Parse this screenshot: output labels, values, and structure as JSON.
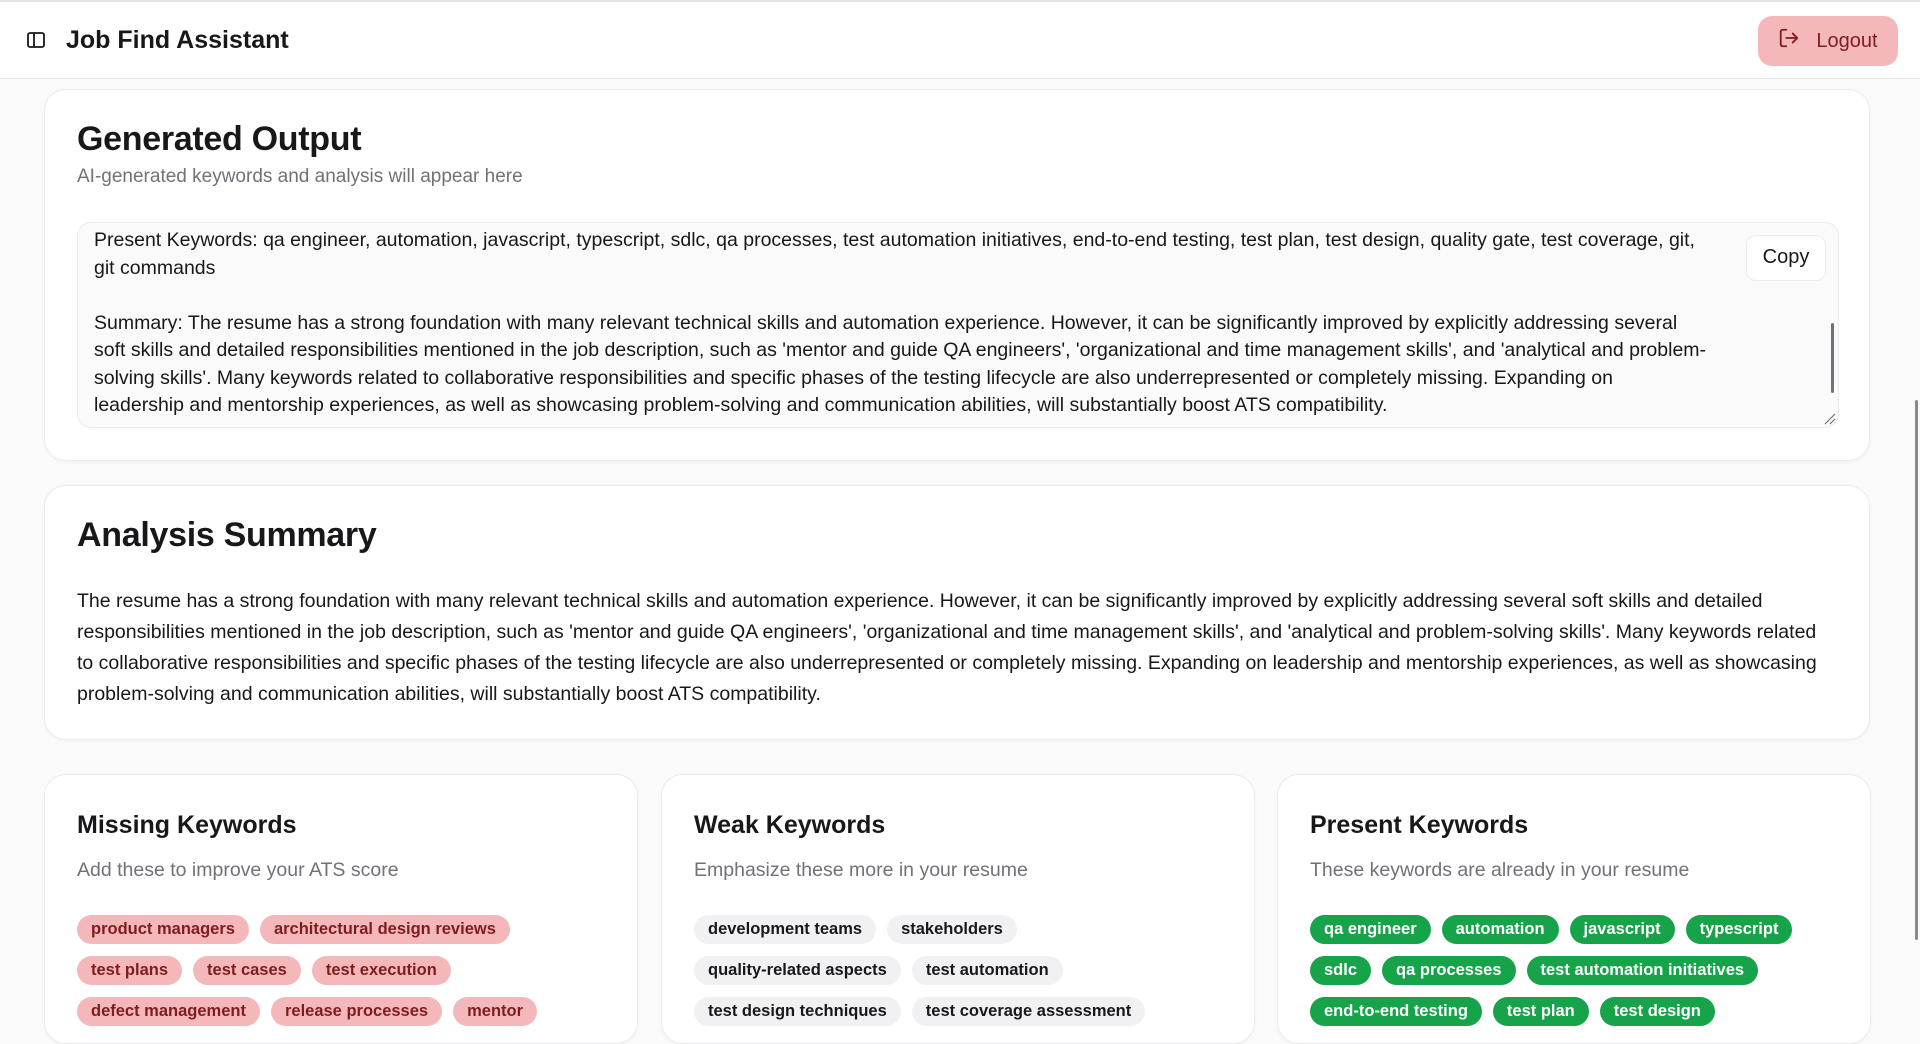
{
  "header": {
    "title": "Job Find Assistant",
    "logout_label": "Logout"
  },
  "generated_output": {
    "title": "Generated Output",
    "subtitle": "AI-generated keywords and analysis will appear here",
    "present_line": "Present Keywords: qa engineer, automation, javascript, typescript, sdlc, qa processes, test automation initiatives, end-to-end testing, test plan, test design, quality gate, test coverage, git, git commands",
    "summary_line": "Summary: The resume has a strong foundation with many relevant technical skills and automation experience. However, it can be significantly improved by explicitly addressing several soft skills and detailed responsibilities mentioned in the job description, such as 'mentor and guide QA engineers', 'organizational and time management skills', and 'analytical and problem-solving skills'. Many keywords related to collaborative responsibilities and specific phases of the testing lifecycle are also underrepresented or completely missing. Expanding on leadership and mentorship experiences, as well as showcasing problem-solving and communication abilities, will substantially boost ATS compatibility.",
    "copy_label": "Copy"
  },
  "analysis_summary": {
    "title": "Analysis Summary",
    "text": "The resume has a strong foundation with many relevant technical skills and automation experience. However, it can be significantly improved by explicitly addressing several soft skills and detailed responsibilities mentioned in the job description, such as 'mentor and guide QA engineers', 'organizational and time management skills', and 'analytical and problem-solving skills'. Many keywords related to collaborative responsibilities and specific phases of the testing lifecycle are also underrepresented or completely missing. Expanding on leadership and mentorship experiences, as well as showcasing problem-solving and communication abilities, will substantially boost ATS compatibility."
  },
  "missing_keywords": {
    "title": "Missing Keywords",
    "subtitle": "Add these to improve your ATS score",
    "items": [
      "product managers",
      "architectural design reviews",
      "test plans",
      "test cases",
      "test execution",
      "defect management",
      "release processes",
      "mentor"
    ]
  },
  "weak_keywords": {
    "title": "Weak Keywords",
    "subtitle": "Emphasize these more in your resume",
    "items": [
      "development teams",
      "stakeholders",
      "quality-related aspects",
      "test automation",
      "test design techniques",
      "test coverage assessment"
    ]
  },
  "present_keywords": {
    "title": "Present Keywords",
    "subtitle": "These keywords are already in your resume",
    "items": [
      "qa engineer",
      "automation",
      "javascript",
      "typescript",
      "sdlc",
      "qa processes",
      "test automation initiatives",
      "end-to-end testing",
      "test plan",
      "test design"
    ]
  },
  "colors": {
    "missing_chip_bg": "#f4b8bb",
    "present_chip_bg": "#16a34a",
    "weak_chip_bg": "#f1f1f3",
    "logout_bg": "#f4b8bb"
  }
}
